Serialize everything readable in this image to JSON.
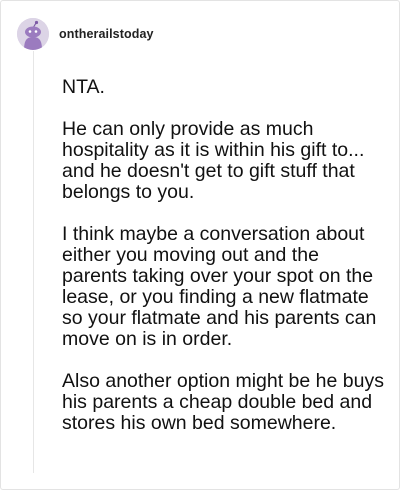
{
  "post": {
    "username": "ontherailstoday",
    "avatar_icon": "snoo-avatar-icon",
    "paragraphs": [
      "NTA.",
      "He can only provide as much hospitality as it is within his gift to... and he doesn't get to gift stuff that belongs to you.",
      "I think maybe a conversation about either you moving out and the parents taking over your spot on the lease, or you finding a new flatmate so your flatmate and his parents can move on is in order.",
      "Also another option might be he buys his parents a cheap double bed and stores his own bed somewhere."
    ]
  },
  "colors": {
    "avatar_bg": "#dcd4e6",
    "avatar_figure": "#9b7bbf",
    "text": "#111111",
    "thread_line": "#e6e6e6"
  }
}
